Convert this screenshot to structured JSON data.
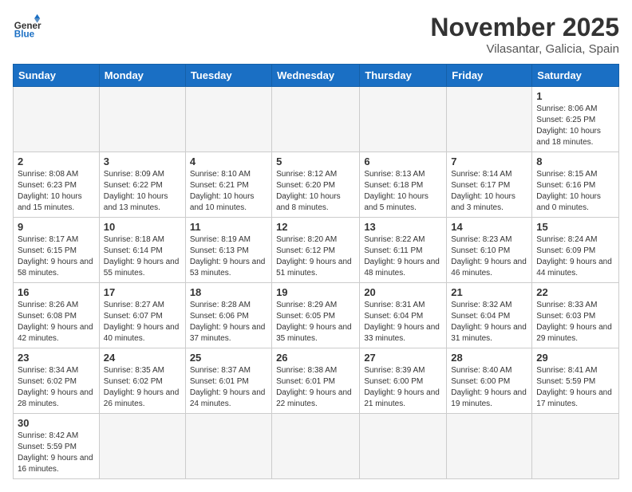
{
  "header": {
    "logo_general": "General",
    "logo_blue": "Blue",
    "month_title": "November 2025",
    "location": "Vilasantar, Galicia, Spain"
  },
  "weekdays": [
    "Sunday",
    "Monday",
    "Tuesday",
    "Wednesday",
    "Thursday",
    "Friday",
    "Saturday"
  ],
  "weeks": [
    [
      {
        "day": "",
        "info": ""
      },
      {
        "day": "",
        "info": ""
      },
      {
        "day": "",
        "info": ""
      },
      {
        "day": "",
        "info": ""
      },
      {
        "day": "",
        "info": ""
      },
      {
        "day": "",
        "info": ""
      },
      {
        "day": "1",
        "info": "Sunrise: 8:06 AM\nSunset: 6:25 PM\nDaylight: 10 hours and 18 minutes."
      }
    ],
    [
      {
        "day": "2",
        "info": "Sunrise: 8:08 AM\nSunset: 6:23 PM\nDaylight: 10 hours and 15 minutes."
      },
      {
        "day": "3",
        "info": "Sunrise: 8:09 AM\nSunset: 6:22 PM\nDaylight: 10 hours and 13 minutes."
      },
      {
        "day": "4",
        "info": "Sunrise: 8:10 AM\nSunset: 6:21 PM\nDaylight: 10 hours and 10 minutes."
      },
      {
        "day": "5",
        "info": "Sunrise: 8:12 AM\nSunset: 6:20 PM\nDaylight: 10 hours and 8 minutes."
      },
      {
        "day": "6",
        "info": "Sunrise: 8:13 AM\nSunset: 6:18 PM\nDaylight: 10 hours and 5 minutes."
      },
      {
        "day": "7",
        "info": "Sunrise: 8:14 AM\nSunset: 6:17 PM\nDaylight: 10 hours and 3 minutes."
      },
      {
        "day": "8",
        "info": "Sunrise: 8:15 AM\nSunset: 6:16 PM\nDaylight: 10 hours and 0 minutes."
      }
    ],
    [
      {
        "day": "9",
        "info": "Sunrise: 8:17 AM\nSunset: 6:15 PM\nDaylight: 9 hours and 58 minutes."
      },
      {
        "day": "10",
        "info": "Sunrise: 8:18 AM\nSunset: 6:14 PM\nDaylight: 9 hours and 55 minutes."
      },
      {
        "day": "11",
        "info": "Sunrise: 8:19 AM\nSunset: 6:13 PM\nDaylight: 9 hours and 53 minutes."
      },
      {
        "day": "12",
        "info": "Sunrise: 8:20 AM\nSunset: 6:12 PM\nDaylight: 9 hours and 51 minutes."
      },
      {
        "day": "13",
        "info": "Sunrise: 8:22 AM\nSunset: 6:11 PM\nDaylight: 9 hours and 48 minutes."
      },
      {
        "day": "14",
        "info": "Sunrise: 8:23 AM\nSunset: 6:10 PM\nDaylight: 9 hours and 46 minutes."
      },
      {
        "day": "15",
        "info": "Sunrise: 8:24 AM\nSunset: 6:09 PM\nDaylight: 9 hours and 44 minutes."
      }
    ],
    [
      {
        "day": "16",
        "info": "Sunrise: 8:26 AM\nSunset: 6:08 PM\nDaylight: 9 hours and 42 minutes."
      },
      {
        "day": "17",
        "info": "Sunrise: 8:27 AM\nSunset: 6:07 PM\nDaylight: 9 hours and 40 minutes."
      },
      {
        "day": "18",
        "info": "Sunrise: 8:28 AM\nSunset: 6:06 PM\nDaylight: 9 hours and 37 minutes."
      },
      {
        "day": "19",
        "info": "Sunrise: 8:29 AM\nSunset: 6:05 PM\nDaylight: 9 hours and 35 minutes."
      },
      {
        "day": "20",
        "info": "Sunrise: 8:31 AM\nSunset: 6:04 PM\nDaylight: 9 hours and 33 minutes."
      },
      {
        "day": "21",
        "info": "Sunrise: 8:32 AM\nSunset: 6:04 PM\nDaylight: 9 hours and 31 minutes."
      },
      {
        "day": "22",
        "info": "Sunrise: 8:33 AM\nSunset: 6:03 PM\nDaylight: 9 hours and 29 minutes."
      }
    ],
    [
      {
        "day": "23",
        "info": "Sunrise: 8:34 AM\nSunset: 6:02 PM\nDaylight: 9 hours and 28 minutes."
      },
      {
        "day": "24",
        "info": "Sunrise: 8:35 AM\nSunset: 6:02 PM\nDaylight: 9 hours and 26 minutes."
      },
      {
        "day": "25",
        "info": "Sunrise: 8:37 AM\nSunset: 6:01 PM\nDaylight: 9 hours and 24 minutes."
      },
      {
        "day": "26",
        "info": "Sunrise: 8:38 AM\nSunset: 6:01 PM\nDaylight: 9 hours and 22 minutes."
      },
      {
        "day": "27",
        "info": "Sunrise: 8:39 AM\nSunset: 6:00 PM\nDaylight: 9 hours and 21 minutes."
      },
      {
        "day": "28",
        "info": "Sunrise: 8:40 AM\nSunset: 6:00 PM\nDaylight: 9 hours and 19 minutes."
      },
      {
        "day": "29",
        "info": "Sunrise: 8:41 AM\nSunset: 5:59 PM\nDaylight: 9 hours and 17 minutes."
      }
    ],
    [
      {
        "day": "30",
        "info": "Sunrise: 8:42 AM\nSunset: 5:59 PM\nDaylight: 9 hours and 16 minutes."
      },
      {
        "day": "",
        "info": ""
      },
      {
        "day": "",
        "info": ""
      },
      {
        "day": "",
        "info": ""
      },
      {
        "day": "",
        "info": ""
      },
      {
        "day": "",
        "info": ""
      },
      {
        "day": "",
        "info": ""
      }
    ]
  ]
}
